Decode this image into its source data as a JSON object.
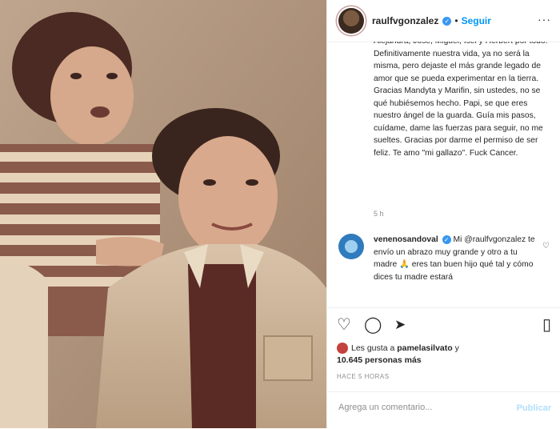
{
  "post": {
    "photo": {
      "icon": "vintage-family-photo"
    }
  },
  "header": {
    "username": "raulfvgonzalez",
    "separator": "•",
    "follow_label": "Seguir",
    "more_label": "···"
  },
  "caption": {
    "text": "Alejandra, José, Miguel, Isel y Herbert por todo. Definitivamente nuestra vida, ya no será la misma, pero dejaste el más grande legado de amor que se pueda experimentar en la tierra. Gracias Mandyta y Marifin, sin ustedes, no se qué hubiésemos hecho. Papi, se que eres nuestro ángel de la guarda. Guía mis pasos, cuídame, dame las fuerzas para seguir, no me sueltes. Gracias por darme el permiso de ser feliz. Te amo \"mi gallazo\". Fuck Cancer.",
    "time": "5 h"
  },
  "comment": {
    "username": "venenosandoval",
    "text": " Mi @raulfvgonzalez te envío un abrazo muy grande y otro a tu madre 🙏 eres tan buen hijo qué tal y cómo dices tu madre estará"
  },
  "actions": {
    "like_icon": "heart-icon",
    "comment_icon": "comment-icon",
    "share_icon": "share-icon",
    "save_icon": "bookmark-icon",
    "like_glyph": "♡",
    "comment_glyph": "◯",
    "share_glyph": "➤",
    "save_glyph": "▯"
  },
  "likes": {
    "prefix": "Les gusta a ",
    "user": "pamelasilvato",
    "middle": " y",
    "count": "10.645 personas más"
  },
  "date": "HACE 5 HORAS",
  "add_comment": {
    "placeholder": "Agrega un comentario...",
    "publish_label": "Publicar"
  },
  "colors": {
    "accent": "#0095f6",
    "verified": "#3897f0"
  }
}
